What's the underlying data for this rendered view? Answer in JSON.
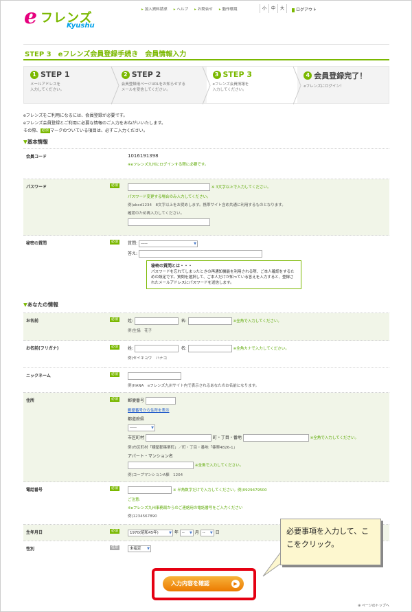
{
  "header": {
    "logo_e": "e",
    "logo_main": "フレンズ",
    "logo_sub": "Kyushu",
    "nav": [
      "加入資料請求",
      "ヘルプ",
      "お問合せ",
      "動作環境"
    ],
    "font_sizes": [
      "小",
      "中",
      "大"
    ],
    "logout": "ログアウト"
  },
  "step_title": "STEP 3　eフレンズ会員登録手続き　会員情報入力",
  "steps": [
    {
      "num": "1",
      "title": "STEP 1",
      "desc": [
        "メールアドレスを",
        "入力してください。"
      ]
    },
    {
      "num": "2",
      "title": "STEP 2",
      "desc": [
        "会員登録用ページURLをお知らせする",
        "メールを受信してください。"
      ]
    },
    {
      "num": "3",
      "title": "STEP 3",
      "desc": [
        "eフレンズ会員情報を",
        "入力してください。"
      ]
    },
    {
      "num": "4",
      "title": "会員登録完了！",
      "desc": [
        "eフレンズにログイン！"
      ]
    }
  ],
  "intro": {
    "line1": "eフレンズをご利用になるには、会員登録が必要です。",
    "line2": "eフレンズ会員登録とご利用に必要な情報のご入力をおねがいいたします。",
    "line3a": "その際、",
    "line3b": "マークのついている項目は、必ずご入力ください。"
  },
  "tags": {
    "required": "必須",
    "optional": "任意"
  },
  "sections": {
    "basic": "基本情報",
    "you": "あなたの情報"
  },
  "fields": {
    "member_code": {
      "label": "会員コード",
      "value": "1016191398",
      "note": "※eフレンズ九州にログインする際に必要です。"
    },
    "password": {
      "label": "パスワード",
      "note1": "※ 3文字以上で入力してください。",
      "note2": "パスワード変更する場合のみ入力してください。",
      "example": "例)abcd1234　8文字以上をお奨めします。携帯サイト含め共通に利用するものとなります。",
      "confirm": "確認のため再入力してください。"
    },
    "secret": {
      "label": "秘密の質問",
      "q_label": "質問:",
      "q_value": "-----",
      "a_label": "答え:",
      "hint_title": "秘密の質問とは・・・",
      "hint_body": "パスワードを忘れてしまったときの再通知機能を利用される際、ご本人確認をするための設定です。質問を選択して、ご本人だけが知っている答えを入力すると、登録されたメールアドレスにパスワードを送信します。"
    },
    "name": {
      "label": "お名前",
      "sei": "姓:",
      "mei": "名:",
      "note": "※全角で入力してください。",
      "example": "例)生協　花子"
    },
    "kana": {
      "label": "お名前(フリガナ)",
      "sei": "姓:",
      "mei": "名:",
      "note": "※全角カナで入力してください。",
      "example": "例)セイキョウ　ハナコ"
    },
    "nickname": {
      "label": "ニックネーム",
      "example": "例)HANA　eフレンズ九州サイト内で表示されるあなたのお名前になります。"
    },
    "address": {
      "label": "住所",
      "zip_label": "郵便番号",
      "zip_link": "郵便番号から住所を表示",
      "pref_label": "都道府県",
      "pref_value": "-----",
      "city_label": "市区町村",
      "town_label": "町・丁目・番地",
      "town_note": "※全角で入力してください。",
      "city_example": "例)市区町村「糟屋郡篠栗町」／町・丁目・番地「篠栗4826-1」",
      "apt_label": "アパート・マンション名",
      "apt_note": "※全角で入力してください。",
      "apt_example": "例)コープマンションA棟　1204"
    },
    "phone": {
      "label": "電話番号",
      "note": "※ 半角数字だけで入力してください。例)0929479500",
      "note2": "ご注意:",
      "note3": "※eフレンズ九州事務局からのご連絡用の電話番号をご入力ください",
      "example": "例)1234567890"
    },
    "birthday": {
      "label": "生年月日",
      "year": "1970(昭和45年)",
      "year_unit": "年",
      "month": "--",
      "month_unit": "月",
      "day": "--",
      "day_unit": "日"
    },
    "gender": {
      "label": "性別",
      "value": "未指定"
    }
  },
  "confirm_button": "入力内容を確認",
  "callout": "必要事項を入力して、ここをクリック。",
  "pagetop": "ページのトップへ",
  "colors": {
    "brand_green": "#7ab800",
    "brand_pink": "#e6007e",
    "highlight_red": "#e50012",
    "button_orange": "#ec7a00"
  }
}
